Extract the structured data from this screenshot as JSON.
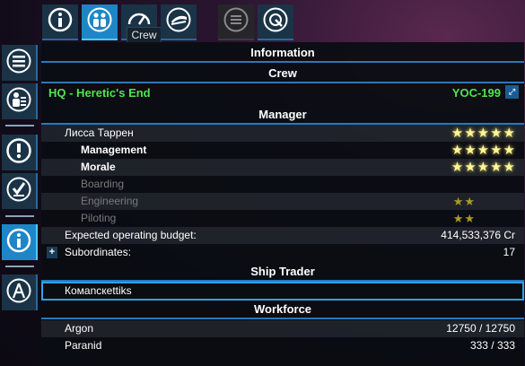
{
  "top_toolbar": {
    "tooltip": "Crew",
    "buttons": [
      {
        "icon": "info-icon",
        "active": false
      },
      {
        "icon": "crew-icon",
        "active": true
      },
      {
        "icon": "gauge-icon",
        "active": false
      },
      {
        "icon": "ship-icon",
        "active": false
      },
      {
        "icon": "list-icon",
        "active": false,
        "disabled": true
      },
      {
        "icon": "target-icon",
        "active": false
      }
    ]
  },
  "left_sidebar": {
    "buttons": [
      {
        "icon": "menu-list-icon",
        "active": false
      },
      {
        "icon": "property-owned-icon",
        "active": false
      },
      {
        "icon": "alert-icon",
        "active": false
      },
      {
        "icon": "standing-orders-icon",
        "active": false
      },
      {
        "icon": "info-icon",
        "active": true
      },
      {
        "icon": "compass-icon",
        "active": false
      }
    ]
  },
  "panel": {
    "title": "Information",
    "crew_header": "Crew",
    "station": {
      "name": "HQ - Heretic's End",
      "code": "YOC-199"
    },
    "manager_header": "Manager",
    "manager": {
      "name": "Лисса Таррен",
      "name_stars": "★★★★★",
      "skills": [
        {
          "label": "Management",
          "stars": "★★★★★",
          "style": "bold"
        },
        {
          "label": "Morale",
          "stars": "★★★★★",
          "style": "bold"
        },
        {
          "label": "Boarding",
          "stars": "",
          "style": "gray"
        },
        {
          "label": "Engineering",
          "stars": "★★",
          "style": "gray"
        },
        {
          "label": "Piloting",
          "stars": "★★",
          "style": "gray"
        }
      ]
    },
    "budget_label": "Expected operating budget:",
    "budget_value": "414,533,376 Cr",
    "subordinates_label": "Subordinates:",
    "subordinates_value": "17",
    "expand_plus": "+",
    "ship_trader_header": "Ship Trader",
    "ship_trader_name": "Комancкеttiks",
    "workforce_header": "Workforce",
    "workforce": [
      {
        "race": "Argon",
        "value": "12750 / 12750"
      },
      {
        "race": "Paranid",
        "value": "333 / 333"
      }
    ]
  }
}
